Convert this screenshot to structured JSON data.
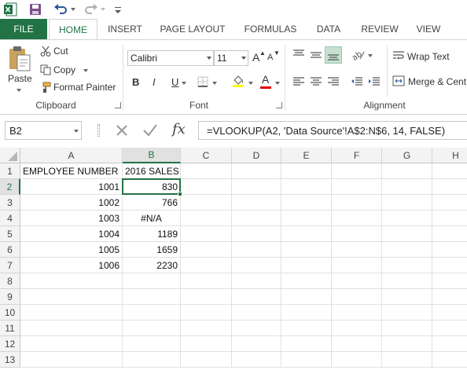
{
  "app": {
    "accent_color": "#217346"
  },
  "qat": {
    "icons": [
      "excel-logo-icon",
      "save-icon",
      "undo-icon",
      "redo-icon",
      "customize-qat-icon"
    ]
  },
  "tabs": {
    "file": "FILE",
    "items": [
      "HOME",
      "INSERT",
      "PAGE LAYOUT",
      "FORMULAS",
      "DATA",
      "REVIEW",
      "VIEW"
    ],
    "active": "HOME"
  },
  "ribbon": {
    "clipboard": {
      "label": "Clipboard",
      "paste": "Paste",
      "cut": "Cut",
      "copy": "Copy",
      "format_painter": "Format Painter"
    },
    "font": {
      "label": "Font",
      "family": "Calibri",
      "size": "11",
      "bold": "B",
      "italic": "I",
      "underline": "U",
      "grow": "A",
      "shrink": "A",
      "font_color_letter": "A"
    },
    "alignment": {
      "label": "Alignment",
      "wrap_text": "Wrap Text",
      "merge_center": "Merge & Cent"
    }
  },
  "formula_bar": {
    "name_box": "B2",
    "fx": "fx",
    "formula": "=VLOOKUP(A2, 'Data Source'!A$2:N$6, 14, FALSE)"
  },
  "sheet": {
    "columns": [
      "A",
      "B",
      "C",
      "D",
      "E",
      "F",
      "G",
      "H"
    ],
    "rows": [
      "1",
      "2",
      "3",
      "4",
      "5",
      "6",
      "7",
      "8",
      "9",
      "10",
      "11",
      "12",
      "13"
    ],
    "selected_cell": "B2",
    "data": [
      [
        "EMPLOYEE NUMBER",
        "2016 SALES"
      ],
      [
        "1001",
        "830"
      ],
      [
        "1002",
        "766"
      ],
      [
        "1003",
        "#N/A"
      ],
      [
        "1004",
        "1189"
      ],
      [
        "1005",
        "1659"
      ],
      [
        "1006",
        "2230"
      ]
    ]
  }
}
